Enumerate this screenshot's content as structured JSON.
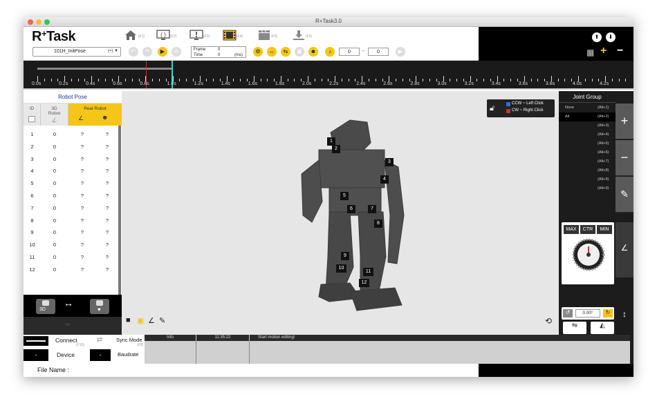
{
  "window": {
    "title": "R+Task3.0"
  },
  "toolbar": {
    "logo": "R",
    "logo_sup": "+",
    "logo_rest": "Task",
    "tools": [
      {
        "icon": "home-icon",
        "glyph": "⌂",
        "key": "(F1)"
      },
      {
        "icon": "monitor-code-icon",
        "glyph": "▭",
        "key": "(F2)"
      },
      {
        "icon": "monitor-alert-icon",
        "glyph": "▭",
        "key": "(F3)"
      },
      {
        "icon": "film-icon",
        "glyph": "▦",
        "key": "(F4)"
      },
      {
        "icon": "clapper-icon",
        "glyph": "▤",
        "key": "(F5)"
      },
      {
        "icon": "download-icon",
        "glyph": "⇩",
        "key": "(F6)"
      }
    ],
    "file_select": {
      "value": "101H_InitPose",
      "suffix": "(=)"
    },
    "frame_label": "Frame",
    "frame_value": "0",
    "time_label": "Time",
    "time_value": "0",
    "time_unit": "(ms)",
    "speed_from": "0",
    "speed_to": "0",
    "dash": "-"
  },
  "timeline": {
    "labels": [
      "0.0s",
      "0.2s",
      "0.4s",
      "0.6s",
      "0.8s",
      "1.0s",
      "1.2s",
      "1.4s",
      "1.6s",
      "1.8s",
      "2.0s",
      "2.2s",
      "2.4s",
      "2.6s",
      "2.8s",
      "3.0s",
      "3.2s",
      "3.4s",
      "3.6s",
      "3.8s",
      "4.0s",
      "4.2s"
    ]
  },
  "robot_pose": {
    "title": "Robot Pose",
    "col_id": "ID",
    "col_3d": "3D Robot",
    "col_real": "Real Robot",
    "rows": [
      {
        "id": "1",
        "v3d": "0",
        "r1": "?",
        "r2": "?"
      },
      {
        "id": "2",
        "v3d": "0",
        "r1": "?",
        "r2": "?"
      },
      {
        "id": "3",
        "v3d": "0",
        "r1": "?",
        "r2": "?"
      },
      {
        "id": "4",
        "v3d": "0",
        "r1": "?",
        "r2": "?"
      },
      {
        "id": "5",
        "v3d": "0",
        "r1": "?",
        "r2": "?"
      },
      {
        "id": "6",
        "v3d": "0",
        "r1": "?",
        "r2": "?"
      },
      {
        "id": "7",
        "v3d": "0",
        "r1": "?",
        "r2": "?"
      },
      {
        "id": "8",
        "v3d": "0",
        "r1": "?",
        "r2": "?"
      },
      {
        "id": "9",
        "v3d": "0",
        "r1": "?",
        "r2": "?"
      },
      {
        "id": "10",
        "v3d": "0",
        "r1": "?",
        "r2": "?"
      },
      {
        "id": "11",
        "v3d": "0",
        "r1": "?",
        "r2": "?"
      },
      {
        "id": "12",
        "v3d": "0",
        "r1": "?",
        "r2": "?"
      }
    ],
    "sim_label": "3D"
  },
  "viewport": {
    "legend_ccw": "CCW ~ Left Click",
    "legend_cw": "CW ~ Right Click",
    "joint_labels": [
      "1",
      "2",
      "3",
      "4",
      "5",
      "6",
      "7",
      "8",
      "9",
      "10",
      "11",
      "12"
    ]
  },
  "joint_group": {
    "title": "Joint Group",
    "items": [
      {
        "name": "None",
        "key": "(Alt+1)"
      },
      {
        "name": "All",
        "key": "(Alt+2)"
      },
      {
        "name": "",
        "key": "(Alt+3)"
      },
      {
        "name": "",
        "key": "(Alt+4)"
      },
      {
        "name": "",
        "key": "(Alt+5)"
      },
      {
        "name": "",
        "key": "(Alt+6)"
      },
      {
        "name": "",
        "key": "(Alt+7)"
      },
      {
        "name": "",
        "key": "(Alt+8)"
      },
      {
        "name": "",
        "key": "(Alt+9)"
      },
      {
        "name": "",
        "key": "(Alt+0)"
      }
    ],
    "add": "+",
    "remove": "−",
    "max_label": "MAX",
    "ctr_label": "CTR",
    "min_label": "MIN",
    "angle_value": "0.00°"
  },
  "status": {
    "connect_label": "Connect",
    "connect_key": "(F10)",
    "sync_label": "Sync Mode",
    "sync_key": "(F9)",
    "device_value": "-",
    "device_label": "Device",
    "baud_value": "-",
    "baud_label": "Baudrate",
    "log_header": "Info",
    "log_time": "11:35:22",
    "log_message": "Start motion editing!"
  },
  "footer": {
    "file_name_label": "File Name :"
  },
  "colors": {
    "accent_yellow": "#f5c518",
    "blue_dark": "#1e3a8a",
    "cyan_marker": "#35d0d8",
    "red_marker": "#c0392b"
  }
}
